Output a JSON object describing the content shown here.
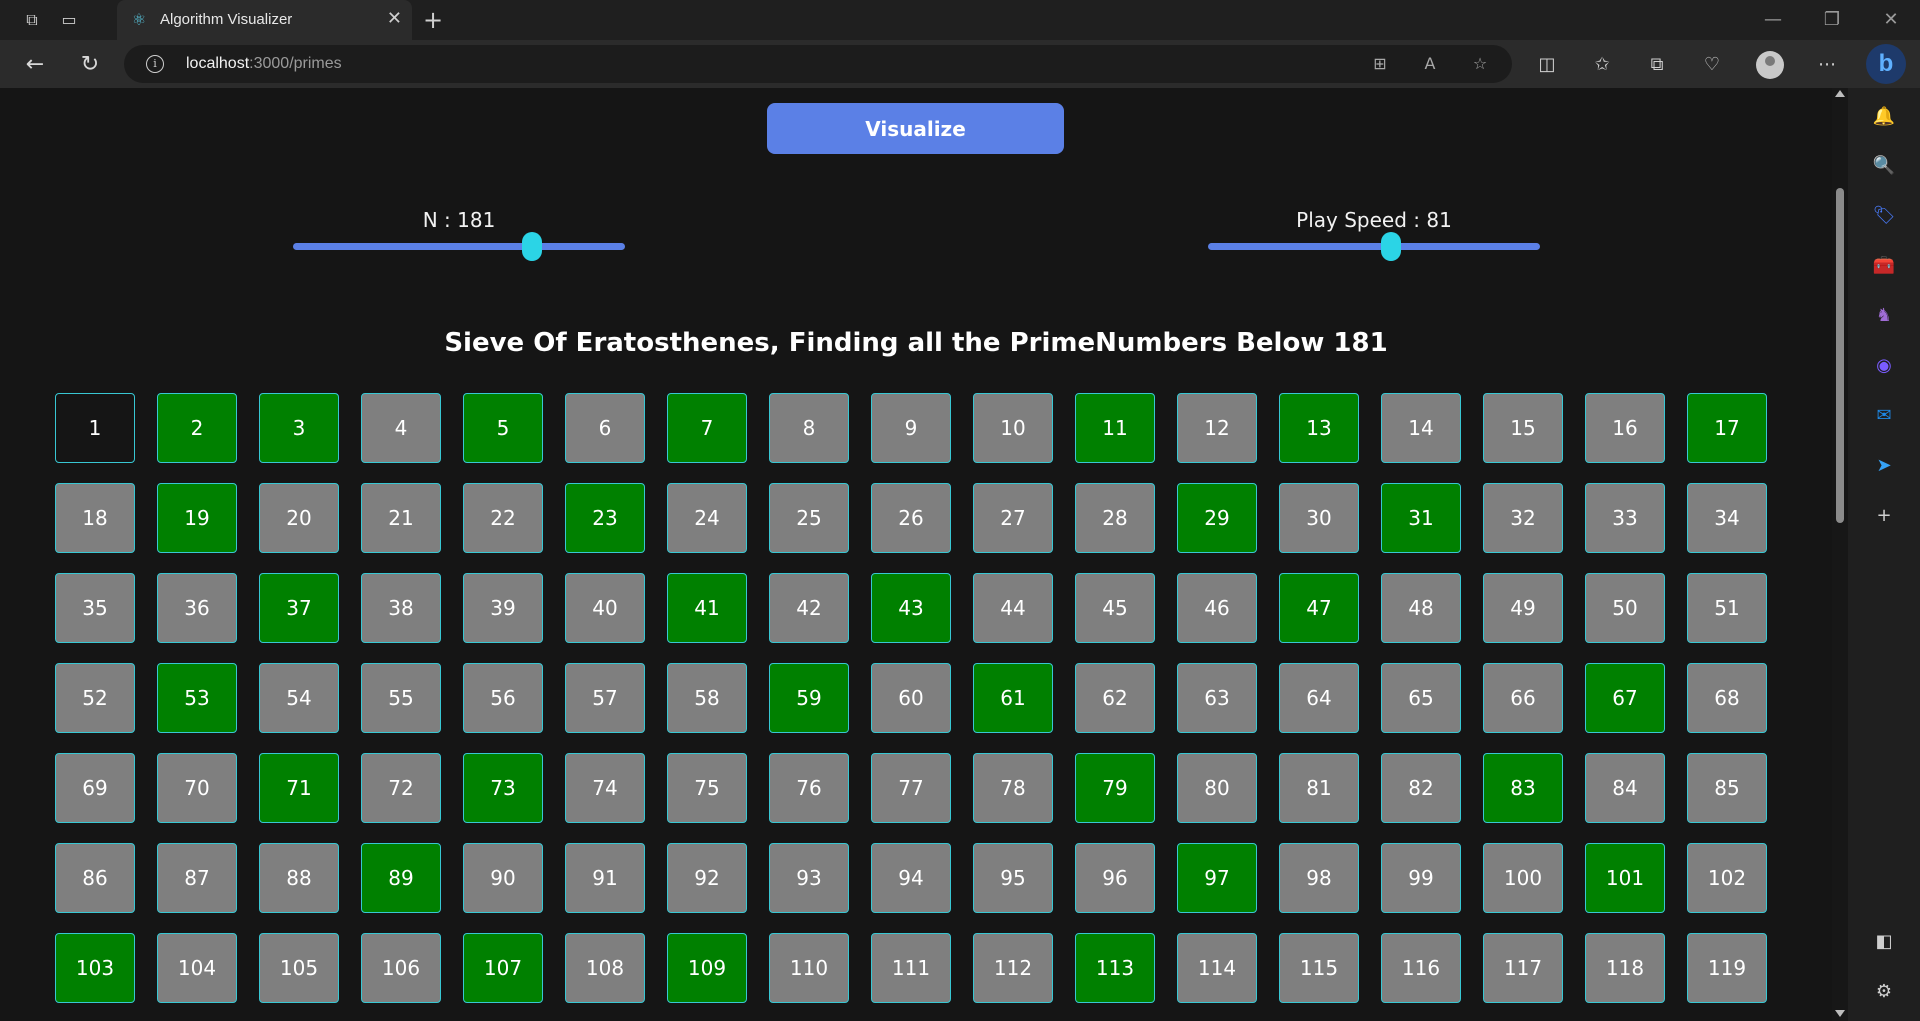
{
  "browser": {
    "tab_title": "Algorithm Visualizer",
    "url_host": "localhost",
    "url_path": ":3000/primes"
  },
  "page": {
    "button_label": "Visualize",
    "n_label": "N : 181",
    "n_value": 181,
    "n_fraction": 0.72,
    "speed_label": "Play Speed : 81",
    "speed_value": 81,
    "speed_fraction": 0.55,
    "title": "Sieve Of Eratosthenes, Finding all the PrimeNumbers Below 181"
  },
  "grid": {
    "visible_numbers_from": 1,
    "visible_numbers_to": 119,
    "unmarked": [
      1
    ],
    "primes": [
      2,
      3,
      5,
      7,
      11,
      13,
      17,
      19,
      23,
      29,
      31,
      37,
      41,
      43,
      47,
      53,
      59,
      61,
      67,
      71,
      73,
      79,
      83,
      89,
      97,
      101,
      103,
      107,
      109,
      113
    ]
  },
  "colors": {
    "prime": "#008000",
    "composite": "#7f7f7f",
    "unmarked": "#151515",
    "cell_border": "#38c7d3",
    "accent": "#5b80e6",
    "slider_thumb": "#2bd4e6"
  },
  "icons": {
    "sidebar": [
      "bell-icon",
      "search-icon",
      "tag-icon",
      "toolbox-icon",
      "chess-icon",
      "copilot-icon",
      "outlook-icon",
      "send-icon",
      "add-icon",
      "panel-icon",
      "settings-icon"
    ]
  }
}
